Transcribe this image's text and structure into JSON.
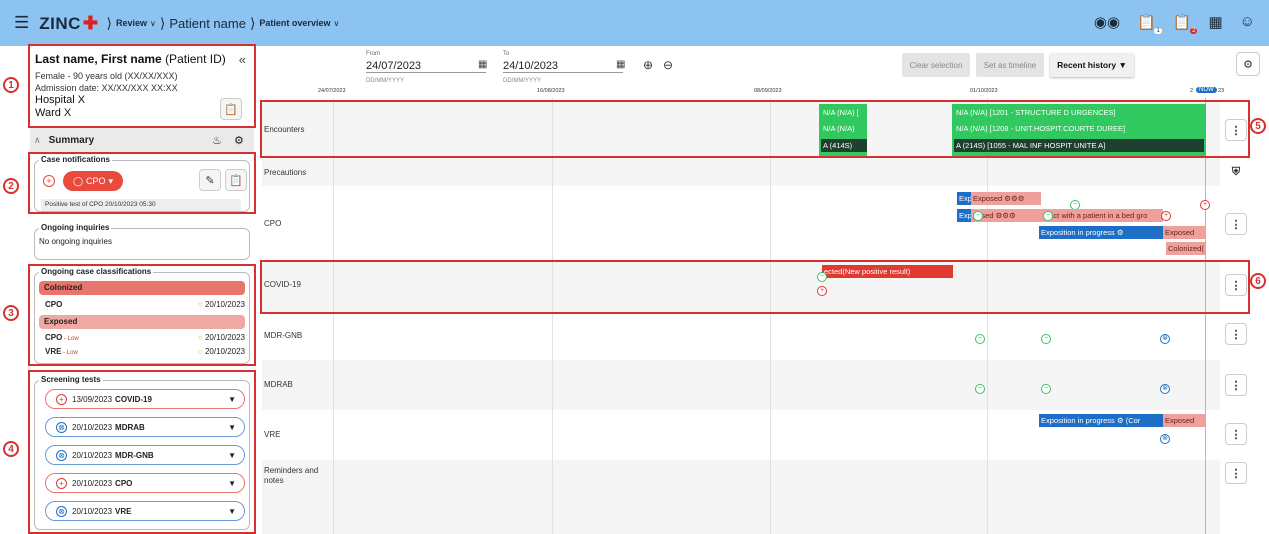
{
  "topbar": {
    "logo": "ZINC",
    "crumbs": [
      "Review",
      "Patient name",
      "Patient overview"
    ],
    "icons": [
      "binoculars-icon",
      "clipboard-icon",
      "clipboard-alert-icon",
      "calendar-icon",
      "user-settings-icon"
    ],
    "badges": {
      "clipboard": "1",
      "clipboard_alert": "2"
    }
  },
  "patient": {
    "name_bold": "Last name, First name",
    "id": "(Patient ID)",
    "sex_age": "Female - 90 years old (XX/XX/XXX)",
    "admission": "Admission date: XX/XX/XXX  XX:XX",
    "hospital": "Hospital X",
    "ward": "Ward X"
  },
  "summary": {
    "label": "Summary"
  },
  "case_notifications": {
    "legend": "Case notifications",
    "pill": "CPO",
    "text": "Positive test of CPO 20/10/2023 05:30"
  },
  "ongoing_inquiries": {
    "legend": "Ongoing inquiries",
    "text": "No ongoing inquiries"
  },
  "classifications": {
    "legend": "Ongoing case classifications",
    "groups": [
      {
        "label": "Colonized",
        "rows": [
          {
            "name": "CPO",
            "level": "",
            "date": "20/10/2023"
          }
        ]
      },
      {
        "label": "Exposed",
        "rows": [
          {
            "name": "CPO",
            "level": " - Low",
            "date": "20/10/2023"
          },
          {
            "name": "VRE",
            "level": " - Low",
            "date": "20/10/2023"
          }
        ]
      }
    ]
  },
  "screening": {
    "legend": "Screening tests",
    "tests": [
      {
        "date": "13/09/2023",
        "name": "COVID-19",
        "kind": "positive"
      },
      {
        "date": "20/10/2023",
        "name": "MDRAB",
        "kind": "negative"
      },
      {
        "date": "20/10/2023",
        "name": "MDR-GNB",
        "kind": "negative"
      },
      {
        "date": "20/10/2023",
        "name": "CPO",
        "kind": "positive"
      },
      {
        "date": "20/10/2023",
        "name": "VRE",
        "kind": "negative"
      }
    ]
  },
  "controls": {
    "from_label": "From",
    "from_value": "24/07/2023",
    "from_hint": "DD/MM/YYYY",
    "to_label": "To",
    "to_value": "24/10/2023",
    "to_hint": "DD/MM/YYYY",
    "clear": "Clear selection",
    "set_timeline": "Set as timeline",
    "recent": "Recent history"
  },
  "axis": {
    "labels": [
      "24/07/2023",
      "16/08/2023",
      "08/09/2023",
      "01/10/2023",
      "2"
    ],
    "now": "NOW",
    "now_suffix": "23"
  },
  "rows": [
    "Encounters",
    "Precautions",
    "CPO",
    "COVID-19",
    "MDR-GNB",
    "MDRAB",
    "VRE",
    "Reminders and notes"
  ],
  "bars": {
    "enc_a1": "N/A (N/A) [",
    "enc_a2": "N/A (N/A)",
    "enc_a3": "A (414S)",
    "enc_b1": "N/A (N/A) [1201 - STRUCTURE D URGENCES]",
    "enc_b2": "N/A (N/A) [1208 - UNIT.HOSPIT.COURTE DUREE]",
    "enc_b3": "A (214S) [1055 - MAL INF HOSPIT UNITE A]",
    "cpo_exp_small1": "Exp",
    "cpo_exp1": "Exposed",
    "cpo_exp_small2": "Exp",
    "cpo_exp2": "posed",
    "cpo_contact": "ntact with a patient in a bed gro",
    "cpo_progress": "Exposition in progress",
    "cpo_exposed3": "Exposed",
    "cpo_colonized": "Colonized(",
    "covid_infected": "ected(New positive result)",
    "vre_progress": "Exposition in progress",
    "vre_cor": "(Cor",
    "vre_exposed": "Exposed"
  },
  "colors": {
    "topbar": "#8cc3f0",
    "annotation": "#d63030",
    "green": "#32c860",
    "blue": "#1e6ec8",
    "salmon": "#f0a09a",
    "red": "#e03a30"
  }
}
